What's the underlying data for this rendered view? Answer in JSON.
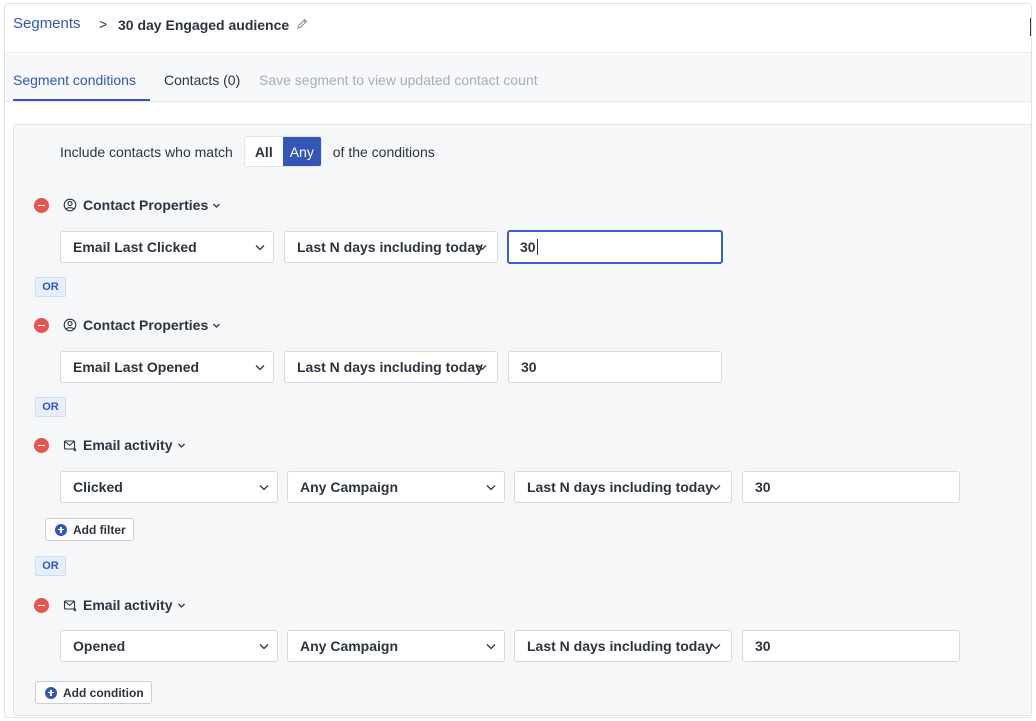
{
  "breadcrumb": {
    "root": "Segments",
    "separator": ">",
    "title": "30 day Engaged audience"
  },
  "tabs": {
    "conditions": "Segment conditions",
    "contacts": "Contacts (0)",
    "note": "Save segment to view updated contact count"
  },
  "match": {
    "prefix": "Include contacts who match",
    "all": "All",
    "any": "Any",
    "selected": "Any",
    "suffix": "of the conditions"
  },
  "conditions": [
    {
      "type": "Contact Properties",
      "icon": "user-circle-icon",
      "property": "Email Last Clicked",
      "operator": "Last N days including today",
      "value": "30"
    },
    {
      "type": "Contact Properties",
      "icon": "user-circle-icon",
      "property": "Email Last Opened",
      "operator": "Last N days including today",
      "value": "30"
    },
    {
      "type": "Email activity",
      "icon": "envelope-icon",
      "action": "Clicked",
      "campaign": "Any Campaign",
      "operator": "Last N days including today",
      "value": "30"
    },
    {
      "type": "Email activity",
      "icon": "envelope-icon",
      "action": "Opened",
      "campaign": "Any Campaign",
      "operator": "Last N days including today",
      "value": "30"
    }
  ],
  "or_label": "OR",
  "add_filter_label": "Add filter",
  "add_condition_label": "Add condition",
  "colors": {
    "accent": "#3356b8",
    "remove": "#e4554f",
    "panel": "#f6f7f9"
  }
}
